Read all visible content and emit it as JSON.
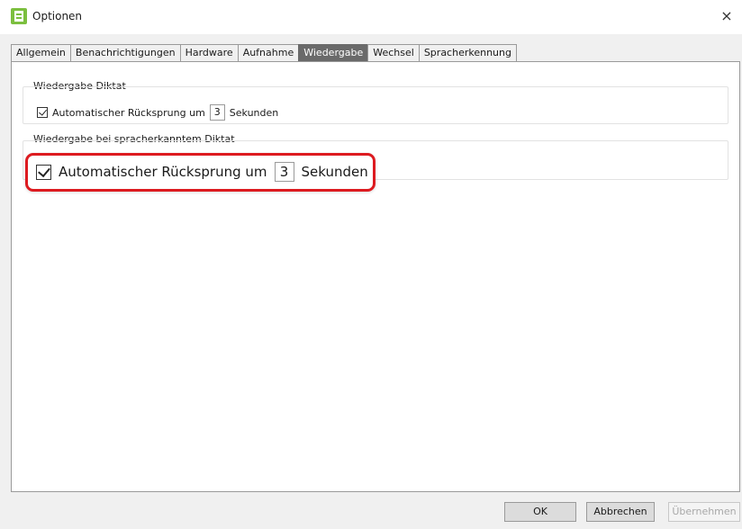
{
  "window": {
    "title": "Optionen",
    "close_symbol": "×"
  },
  "tabs": [
    "Allgemein",
    "Benachrichtigungen",
    "Hardware",
    "Aufnahme",
    "Wiedergabe",
    "Wechsel",
    "Spracherkennung"
  ],
  "active_tab": "Wiedergabe",
  "section1": {
    "title": "Wiedergabe Diktat",
    "checkbox_label": "Automatischer Rücksprung um",
    "checked": true,
    "value": "3",
    "unit": "Sekunden"
  },
  "section2": {
    "title": "Wiedergabe bei spracherkanntem Diktat",
    "checkbox_label": "Automatischer Rücksprung um",
    "checked": true,
    "value": "3",
    "unit": "Sekunden"
  },
  "highlight_color": "#dd1b20",
  "buttons": {
    "ok": "OK",
    "cancel": "Abbrechen",
    "apply": "Übernehmen"
  }
}
